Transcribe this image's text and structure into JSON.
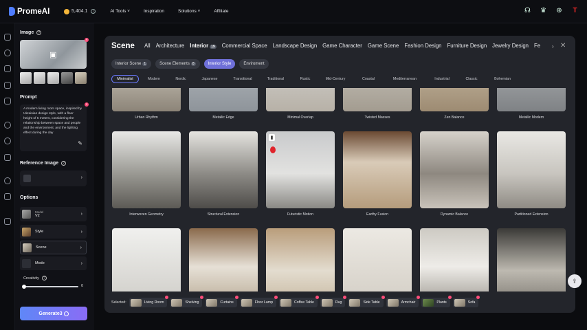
{
  "brand": {
    "name": "PromeAI",
    "accent": "#4f7dff"
  },
  "topbar": {
    "credits": "5,404.1",
    "nav": [
      "AI Tools",
      "Inspiration",
      "Solutions",
      "Affiliate"
    ]
  },
  "panel": {
    "image_title": "Image",
    "prompt_title": "Prompt",
    "prompt_text": "A modern living room space, inspired by Ukrainian design style, with a floor height of 5 meters, considering the relationship between space and people and the environment, and the lighting effect during the day",
    "reference_title": "Reference Image",
    "options_title": "Options",
    "model_label": "Model",
    "model_value": "V2",
    "style_label": "Style",
    "scene_label": "Scene",
    "mode_label": "Mode",
    "creativity_label": "Creativity",
    "creativity_value": "0",
    "generate_label": "Generate3"
  },
  "modal": {
    "title": "Scene",
    "categories": [
      "All",
      "Architecture",
      "Interior",
      "Commercial Space",
      "Landscape Design",
      "Game Character",
      "Game Scene",
      "Fashion Design",
      "Furniture Design",
      "Jewelry Design",
      "Fe"
    ],
    "interior_badge": "19",
    "sub_tabs": [
      {
        "label": "Interior Scene",
        "badge": "1"
      },
      {
        "label": "Scene Elements",
        "badge": "8"
      },
      {
        "label": "Interior Style",
        "badge": ""
      },
      {
        "label": "Enviroment",
        "badge": ""
      }
    ],
    "styles": [
      "Minimalist",
      "Modern",
      "Nordic",
      "Japanese",
      "Transitional",
      "Traditional",
      "Rustic",
      "Mid-Century",
      "Coastal",
      "Mediterranean",
      "Industrial",
      "Classic",
      "Bohemian"
    ],
    "row1": [
      "Urban Rhythm",
      "Metallic Edge",
      "Minimal Overlap",
      "Twisted Masses",
      "Zen Balance",
      "Metallic Modern"
    ],
    "row2": [
      "Interwoven Geometry",
      "Structural Extension",
      "Futuristic Motion",
      "Earthy Fusion",
      "Dynamic Balance",
      "Partitioned Extension"
    ],
    "selected_label": "Selected:",
    "selected": [
      "Living Room",
      "Shelving",
      "Curtains",
      "Floor Lamp",
      "Coffee Table",
      "Rug",
      "Side Table",
      "Armchair",
      "Plants",
      "Sofa"
    ]
  }
}
